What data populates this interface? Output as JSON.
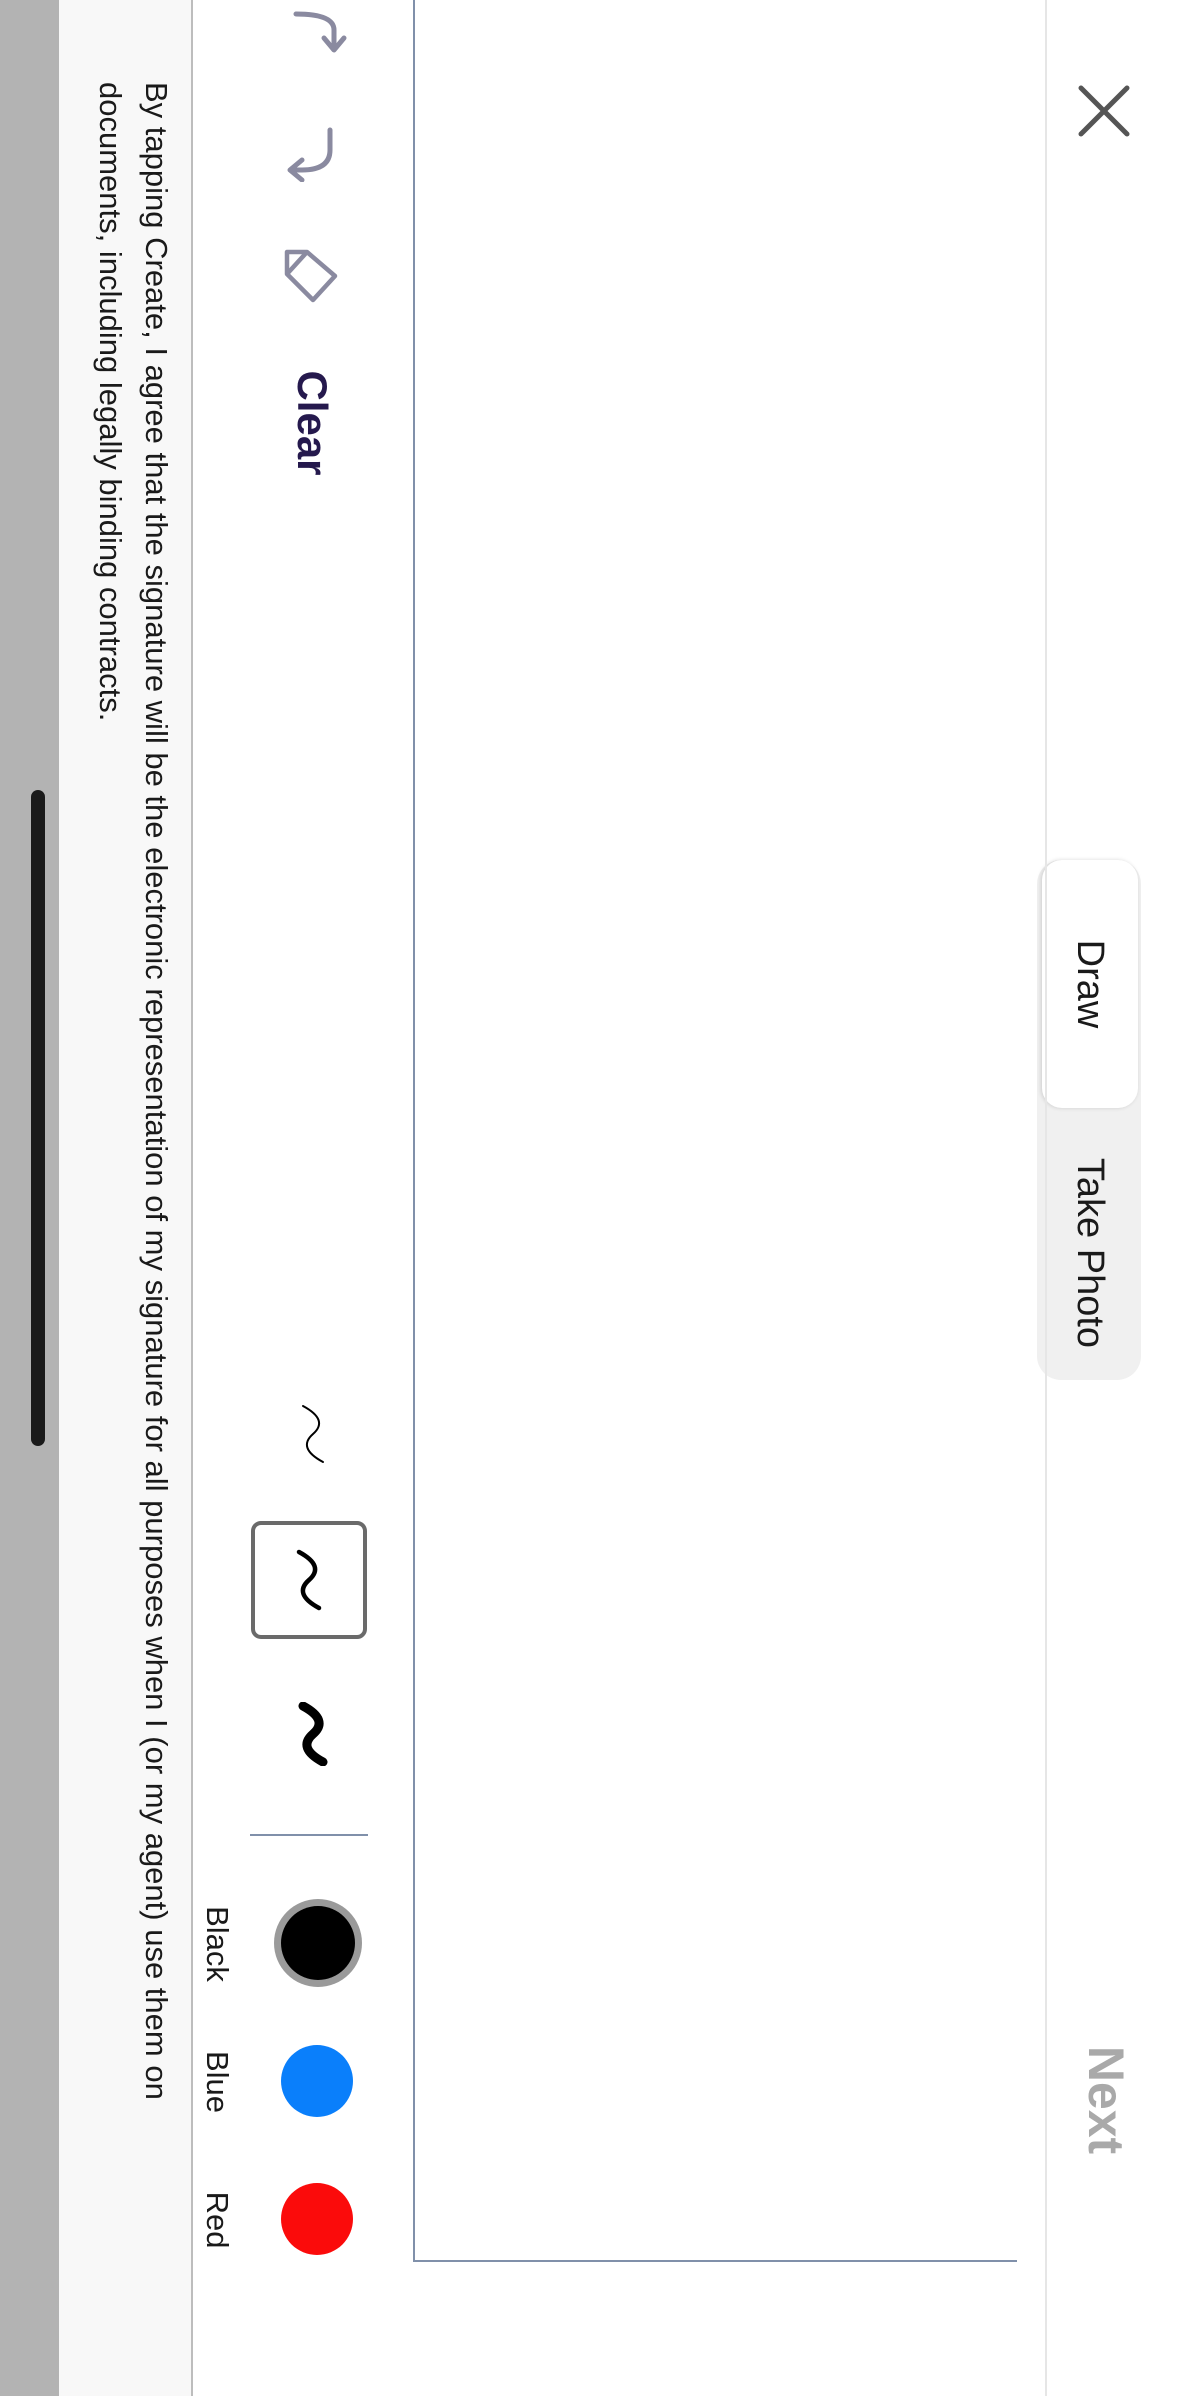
{
  "header": {
    "close_icon": "close-icon",
    "next_label": "Next"
  },
  "tabs": [
    {
      "label": "Draw",
      "selected": true
    },
    {
      "label": "Take Photo",
      "selected": false
    }
  ],
  "toolbar": {
    "undo_icon": "undo-icon",
    "redo_icon": "redo-icon",
    "eraser_icon": "eraser-icon",
    "clear_label": "Clear",
    "stroke_options": [
      "thin",
      "medium",
      "thick"
    ],
    "selected_stroke": "medium",
    "colors": [
      {
        "label": "Black",
        "hex": "#000000",
        "selected": true
      },
      {
        "label": "Blue",
        "hex": "#0a7ffb",
        "selected": false
      },
      {
        "label": "Red",
        "hex": "#fb0b0b",
        "selected": false
      }
    ]
  },
  "disclaimer": "By tapping Create, I agree that the signature will be the electronic representation of my signature for all purposes when I (or my agent) use them on documents, including legally binding contracts.",
  "theme": {
    "accent": "#25194d",
    "icon_gray": "#8a8aa0",
    "border": "#8090aa"
  }
}
